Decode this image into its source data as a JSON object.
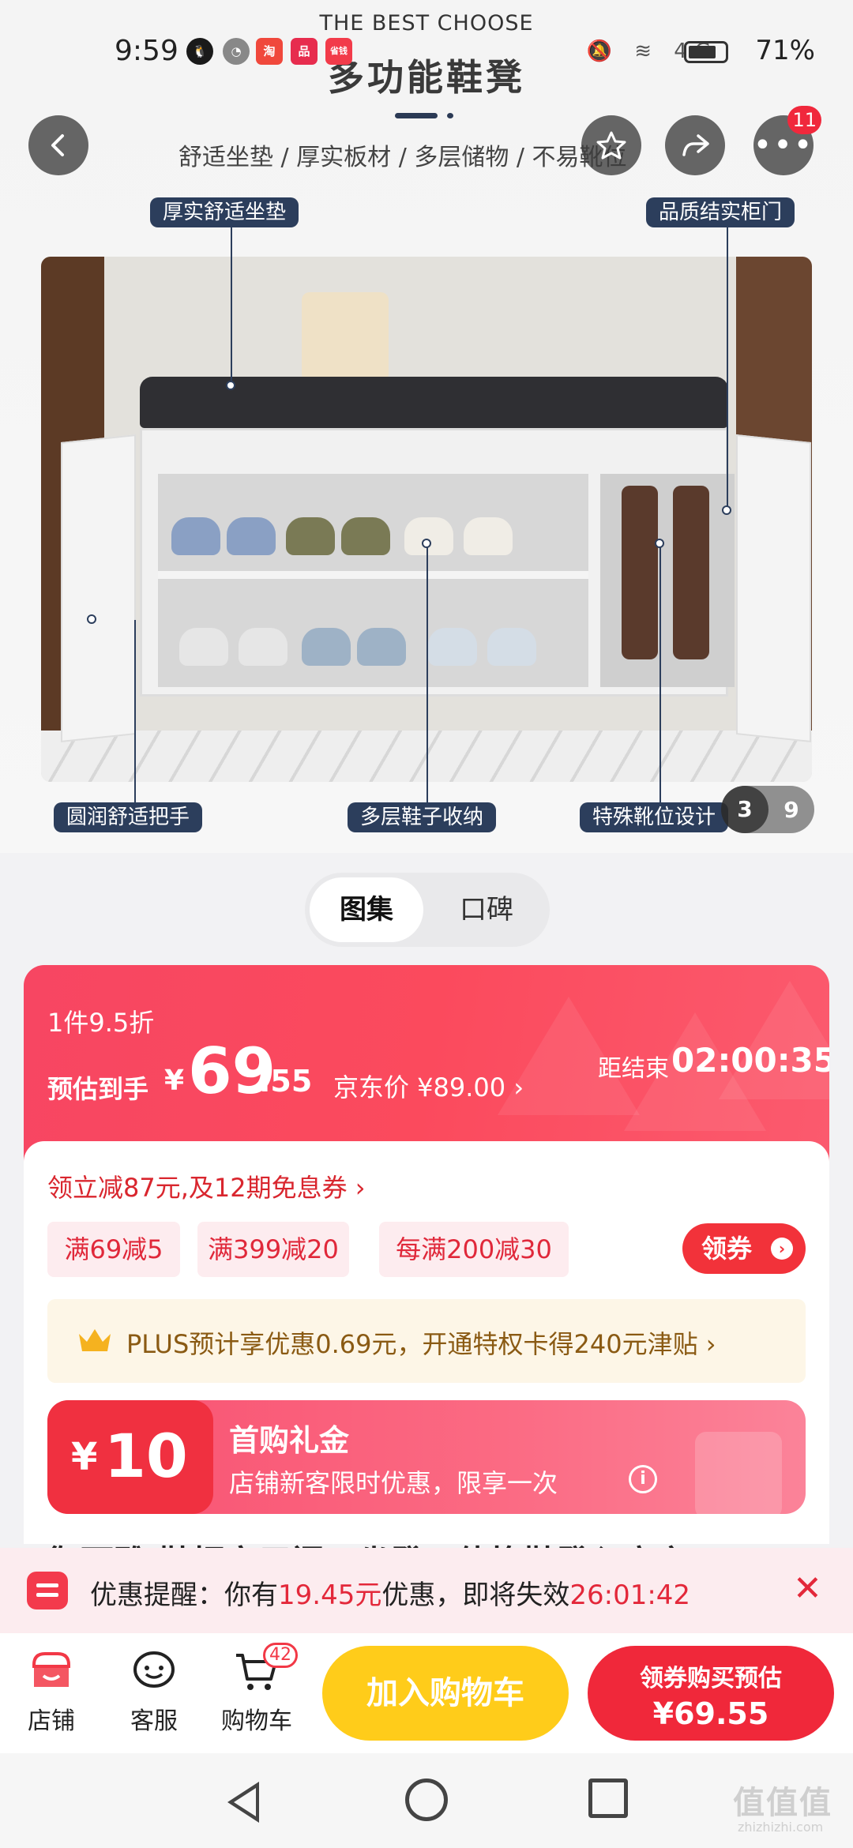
{
  "status_bar": {
    "time": "9:59",
    "battery": "71%",
    "apps": [
      {
        "label": "淘",
        "color": "#f0483c"
      },
      {
        "label": "品",
        "color": "#e72c4e"
      },
      {
        "label": "省钱",
        "color": "#f23b4a"
      }
    ],
    "signal_label": "4G"
  },
  "hero": {
    "brand": "THE BEST CHOOSE",
    "title": "多功能鞋凳",
    "subtitle": "舒适坐垫 / 厚实板材 / 多层储物 / 不易靴位",
    "callouts": {
      "cushion": "厚实舒适坐垫",
      "door": "品质结实柜门",
      "handle": "圆润舒适把手",
      "shoes": "多层鞋子收纳",
      "boots": "特殊靴位设计"
    },
    "page_current": "3",
    "page_total": "9"
  },
  "top_actions": {
    "more_badge": "11"
  },
  "tabs": [
    {
      "label": "图集"
    },
    {
      "label": "口碑"
    }
  ],
  "price": {
    "discount_note": "1件9.5折",
    "est_label": "预估到手",
    "est_currency": "¥",
    "est_int": "69",
    "est_dec": ".55",
    "jd_price": "京东价 ¥89.00 ›",
    "countdown_label": "距结束",
    "countdown": "02:00:35"
  },
  "coupons": {
    "title": "领立减87元,及12期免息券 ›",
    "chips": [
      "满69减5",
      "满399减20",
      "每满200减30"
    ],
    "get_button": "领券",
    "plus_text": "PLUS预计享优惠0.69元，开通特权卡得240元津贴 ›"
  },
  "gift": {
    "currency": "¥",
    "amount": "10",
    "title": "首购礼金",
    "desc": "店铺新客限时优惠，限享一次"
  },
  "product_title": "御丽雅 鞋柜家用门口坐凳一体换鞋凳入户玄",
  "reminder": {
    "prefix": "优惠提醒：你有",
    "amount": "19.45元",
    "middle": "优惠，即将失效",
    "timer": "26:01:42"
  },
  "bottom_bar": {
    "store": "店铺",
    "service": "客服",
    "cart": "购物车",
    "cart_count": "42",
    "add_to_cart": "加入购物车",
    "buy_line1": "领券购买预估",
    "buy_line2": "¥69.55"
  },
  "watermark": {
    "main": "值值值",
    "sub": "zhizhizhi.com"
  }
}
